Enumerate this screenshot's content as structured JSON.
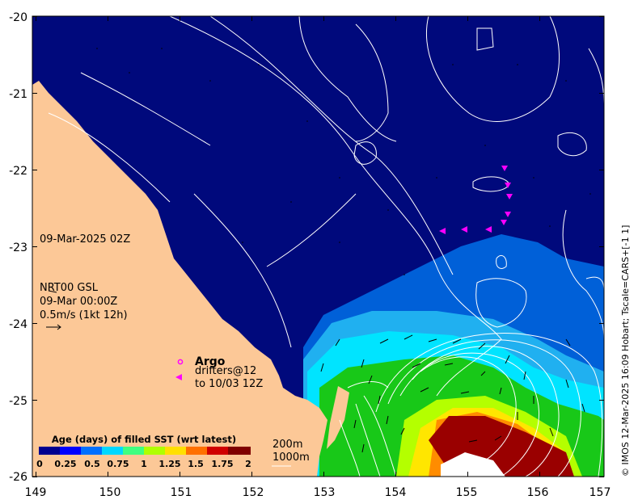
{
  "map": {
    "lon_ticks": [
      "149",
      "150",
      "151",
      "152",
      "153",
      "154",
      "155",
      "156",
      "157"
    ],
    "lat_ticks": [
      "-20",
      "-21",
      "-22",
      "-23",
      "-24",
      "-25",
      "-26"
    ],
    "lon_range": [
      149,
      157
    ],
    "lat_range": [
      -26,
      -20
    ],
    "colors": {
      "land": "#fcc897",
      "sea_base": "#00097c",
      "contour": "#ffffff",
      "argo_marker": "#ff00ff",
      "drifter_marker": "#ff00ff"
    }
  },
  "annotations": {
    "sst_time": "09-Mar-2025 02Z",
    "current_model": "NRT00 GSL",
    "current_time": "09-Mar 00:00Z",
    "vector_scale": "0.5m/s (1kt 12h)",
    "argo_label": "Argo",
    "drifters_line1": "drifters@12",
    "drifters_line2": "to 10/03 12Z",
    "depth_200": "200m",
    "depth_1000": "1000m"
  },
  "colorbar": {
    "title": "Age (days) of filled SST (wrt latest)",
    "ticks": [
      "0",
      "0.25",
      "0.5",
      "0.75",
      "1",
      "1.25",
      "1.5",
      "1.75",
      "2"
    ],
    "colors": [
      "#00008f",
      "#0000ff",
      "#0070ff",
      "#00d8ff",
      "#40ff80",
      "#b0ff00",
      "#ffe000",
      "#ff7000",
      "#d00000",
      "#800000"
    ]
  },
  "credit": "© IMOS 12-Mar-2025 16:09 Hobart; Tscale=CARS+[-1 1]"
}
